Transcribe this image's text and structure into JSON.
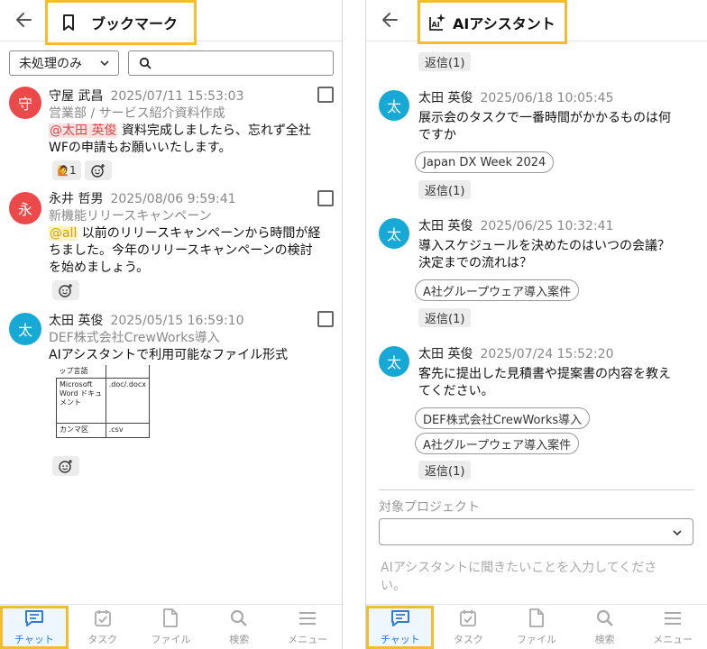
{
  "bookmark": {
    "title": "ブックマーク",
    "filter": {
      "selected": "未処理のみ"
    },
    "search": {
      "value": ""
    },
    "messages": [
      {
        "avatar": "守",
        "name": "守屋 武昌",
        "time": "2025/07/11 15:53:03",
        "project": "営業部 / サービス紹介資料作成",
        "mention": "@太田 英俊",
        "text_line1": " 資料完成しましたら、忘れず全社",
        "text_line2": "WFの申請もお願いいたします。",
        "reaction": {
          "emoji": "🙋",
          "count": "1"
        }
      },
      {
        "avatar": "永",
        "name": "永井 哲男",
        "time": "2025/08/06 9:59:41",
        "project": "新機能リリースキャンペーン",
        "mention": "@all",
        "text_line1": " 以前のリリースキャンペーンから時間が経",
        "text_line2": "ちました。今年のリリースキャンペーンの検討",
        "text_line3": "を始めましょう。"
      },
      {
        "avatar": "太",
        "name": "太田 英俊",
        "time": "2025/05/15 16:59:10",
        "project": "DEF株式会社CrewWorks導入",
        "text_line1": "AIアシスタントで利用可能なファイル形式",
        "table": {
          "header": "ップ言語",
          "row1_col1": "Microsoft Word ドキュメント",
          "row1_col2": ".doc/.docx",
          "row2_col1": "カンマ区",
          "row2_col2": ".csv"
        }
      }
    ]
  },
  "ai": {
    "title": "AIアシスタント",
    "reply_label": "返信(1)",
    "messages": [
      {
        "avatar": "太",
        "name": "太田 英俊",
        "time": "2025/06/18 10:05:45",
        "text_line1": "展示会のタスクで一番時間がかかるものは何",
        "text_line2": "ですか",
        "chips": [
          "Japan DX Week 2024"
        ]
      },
      {
        "avatar": "太",
        "name": "太田 英俊",
        "time": "2025/06/25 10:32:41",
        "text_line1": "導入スケジュールを決めたのはいつの会議？",
        "text_line2": "決定までの流れは？",
        "chips": [
          "A社グループウェア導入案件"
        ]
      },
      {
        "avatar": "太",
        "name": "太田 英俊",
        "time": "2025/07/24 15:52:20",
        "text_line1": "客先に提出した見積書や提案書の内容を教え",
        "text_line2": "てください。",
        "chips": [
          "DEF株式会社CrewWorks導入",
          "A社グループウェア導入案件"
        ]
      }
    ],
    "project_label": "対象プロジェクト",
    "project_value": "",
    "input_placeholder_line1": "AIアシスタントに聞きたいことを入力してくださ",
    "input_placeholder_line2": "い。"
  },
  "nav": {
    "items": [
      {
        "label": "チャット"
      },
      {
        "label": "タスク"
      },
      {
        "label": "ファイル"
      },
      {
        "label": "検索"
      },
      {
        "label": "メニュー"
      }
    ]
  },
  "colors": {
    "accent_highlight": "#f5bd2a",
    "nav_active": "#2f7bd6",
    "avatar_red": "#ec4a4a",
    "avatar_blue": "#17a9d6",
    "mention_red": "#e04646",
    "mention_yellow": "#d7a100"
  },
  "icons": {
    "back": "arrow-left-icon",
    "bookmark": "bookmark-icon",
    "ai": "ai-sparkle-icon",
    "search": "search-icon",
    "chevron": "chevron-down-icon",
    "add_reaction": "add-reaction-icon",
    "nav": [
      "chat-icon",
      "task-icon",
      "file-icon",
      "search-icon",
      "menu-icon"
    ]
  }
}
